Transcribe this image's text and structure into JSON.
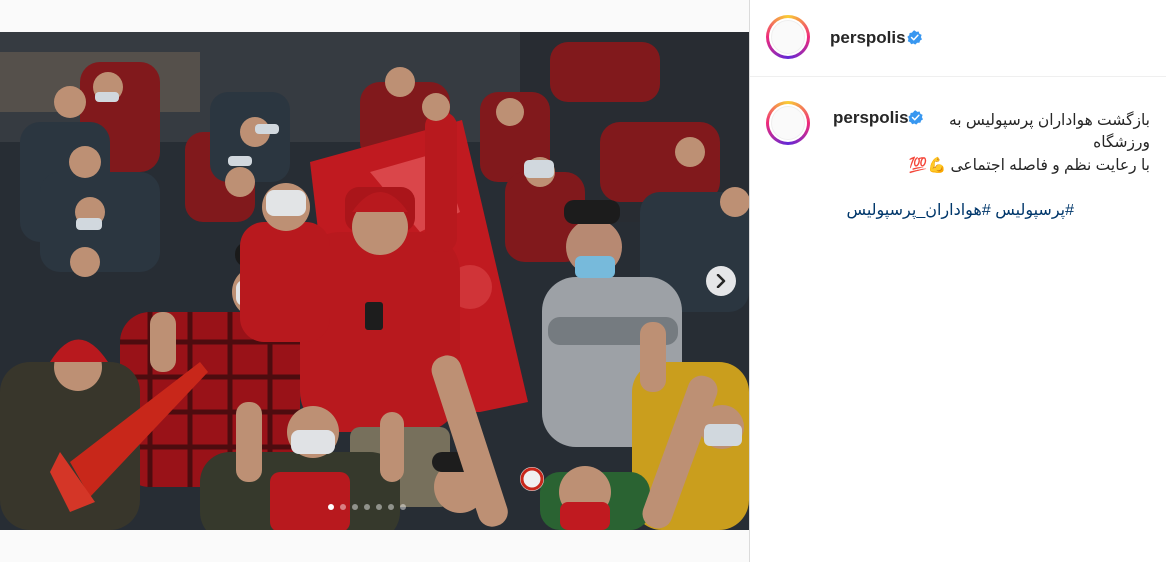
{
  "account": {
    "username": "perspolis"
  },
  "caption": {
    "line1": "بازگشت هواداران پرسپولیس به",
    "line2": "ورزشگاه",
    "line3": "با رعایت نظم و فاصله اجتماعی",
    "emojis": "💪💯",
    "hashtag1": "#پرسپولیس",
    "hashtag2": "#هواداران_پرسپولیس"
  },
  "carousel": {
    "dot_count": 7,
    "active_index": 0
  },
  "icons": {
    "verified": "verified-badge-icon",
    "next": "chevron-right-icon"
  },
  "colors": {
    "verified_blue": "#3897f0",
    "hashtag": "#00376b",
    "fans_red": "#c8191e"
  }
}
